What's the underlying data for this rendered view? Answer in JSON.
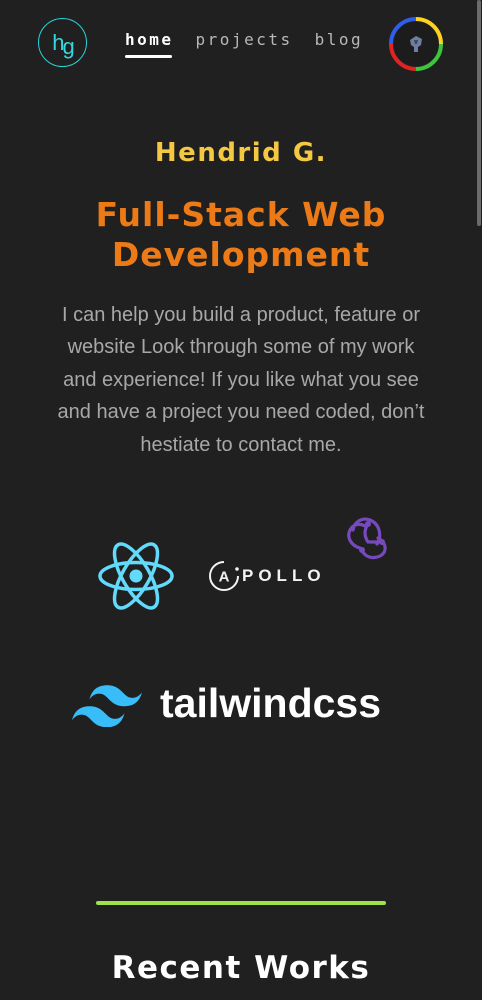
{
  "logo": {
    "text_h": "h",
    "text_g": "g"
  },
  "nav": {
    "items": [
      {
        "label": "home",
        "active": true
      },
      {
        "label": "projects"
      },
      {
        "label": "blog"
      }
    ]
  },
  "hero": {
    "name": "Hendrid G.",
    "headline": "Full-Stack Web Development",
    "intro": "I can help you build a product, feature or website Look through some of my work and experience! If you like what you see and have a project you need coded, don’t hestiate to contact me."
  },
  "tech_logos": {
    "icons": [
      "react-icon",
      "apollo-icon",
      "redux-icon",
      "tailwind-icon"
    ],
    "apollo_label": "POLLO",
    "apollo_letter": "A",
    "tailwind_label": "tailwindcss"
  },
  "sections": {
    "recent_works_title": "Recent Works"
  },
  "colors": {
    "background": "#202020",
    "name": "#f5c842",
    "headline": "#ec7a16",
    "intro": "#a8a8a8",
    "accent_logo": "#2ad2d8",
    "react": "#61dafb",
    "redux": "#764abc",
    "tailwind": "#38bdf8",
    "divider": "#9fe24a"
  }
}
